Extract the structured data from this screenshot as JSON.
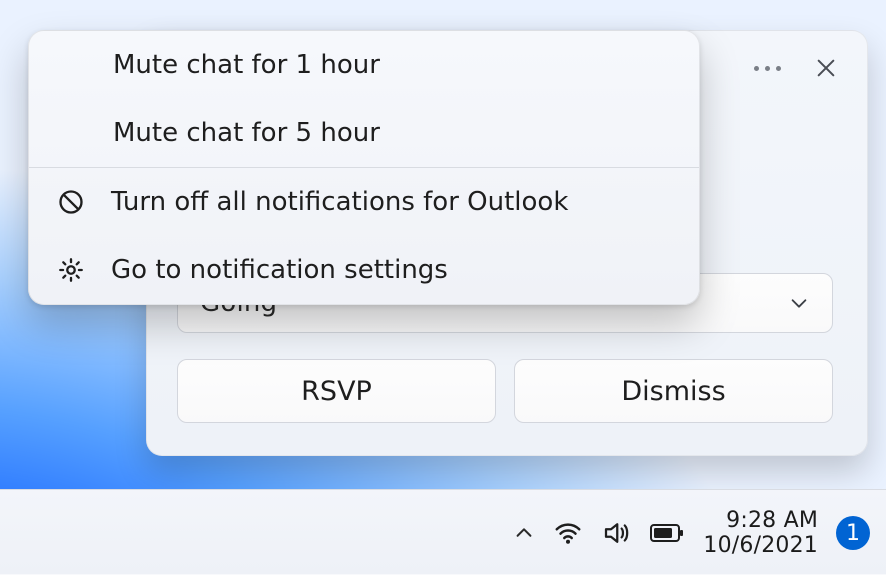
{
  "toast": {
    "dropdown": {
      "selected": "Going"
    },
    "buttons": {
      "rsvp": "RSVP",
      "dismiss": "Dismiss"
    }
  },
  "menu": {
    "mute1h": "Mute chat for 1 hour",
    "mute5h": "Mute chat for 5 hour",
    "turnOff": "Turn off all notifications for Outlook",
    "settings": "Go to notification settings"
  },
  "taskbar": {
    "time": "9:28 AM",
    "date": "10/6/2021",
    "badgeCount": "1"
  }
}
